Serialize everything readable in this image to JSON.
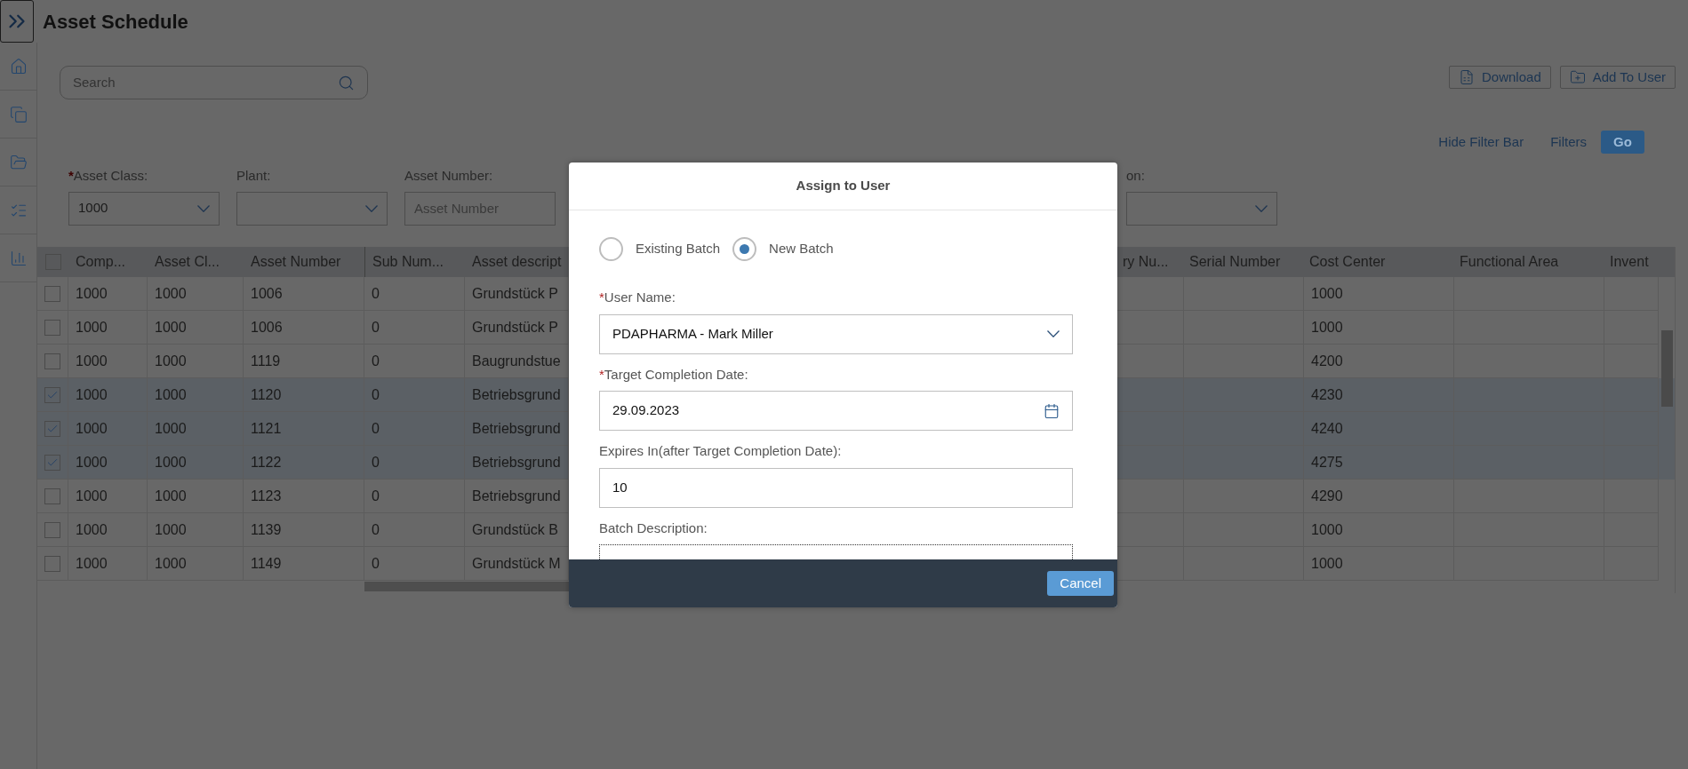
{
  "app": {
    "title": "Asset Schedule"
  },
  "search": {
    "placeholder": "Search"
  },
  "toolbar": {
    "buttons": [
      {
        "label": "Download",
        "kind": "download"
      },
      {
        "label": "Add To User",
        "kind": "add"
      }
    ]
  },
  "filter_bar": {
    "actions": [
      {
        "label": "Hide Filter Bar",
        "kind": "link"
      },
      {
        "label": "Filters",
        "kind": "link"
      },
      {
        "label": "Go",
        "kind": "primary"
      }
    ],
    "filters": [
      {
        "label": "Asset Class:",
        "required_mark": "*",
        "kind": "select",
        "value": "1000"
      },
      {
        "label": "Plant:",
        "kind": "select"
      },
      {
        "label": "Asset Number:",
        "kind": "input",
        "placeholder": "Asset Number"
      },
      {
        "label": "on:",
        "kind": "select"
      }
    ]
  },
  "table": {
    "select_all": false,
    "columns": [
      {
        "label": "Comp..."
      },
      {
        "label": "Asset Cl..."
      },
      {
        "label": "Asset Number"
      },
      {
        "label": "Sub Num..."
      },
      {
        "label": "Asset descript"
      },
      {
        "label": "ry Nu..."
      },
      {
        "label": "Serial Number"
      },
      {
        "label": "Cost Center"
      },
      {
        "label": "Functional Area"
      },
      {
        "label": "Invent"
      }
    ],
    "rows": [
      {
        "selected": false,
        "company": "1000",
        "asset_class": "1000",
        "asset_number": "1006",
        "sub_number": "0",
        "description": "Grundstück P",
        "cost_center": "1000"
      },
      {
        "selected": false,
        "company": "1000",
        "asset_class": "1000",
        "asset_number": "1006",
        "sub_number": "0",
        "description": "Grundstück P",
        "cost_center": "1000"
      },
      {
        "selected": false,
        "company": "1000",
        "asset_class": "1000",
        "asset_number": "1119",
        "sub_number": "0",
        "description": "Baugrundstue",
        "cost_center": "4200"
      },
      {
        "selected": true,
        "company": "1000",
        "asset_class": "1000",
        "asset_number": "1120",
        "sub_number": "0",
        "description": "Betriebsgrund",
        "cost_center": "4230"
      },
      {
        "selected": true,
        "company": "1000",
        "asset_class": "1000",
        "asset_number": "1121",
        "sub_number": "0",
        "description": "Betriebsgrund",
        "cost_center": "4240"
      },
      {
        "selected": true,
        "company": "1000",
        "asset_class": "1000",
        "asset_number": "1122",
        "sub_number": "0",
        "description": "Betriebsgrund",
        "cost_center": "4275"
      },
      {
        "selected": false,
        "company": "1000",
        "asset_class": "1000",
        "asset_number": "1123",
        "sub_number": "0",
        "description": "Betriebsgrund",
        "cost_center": "4290"
      },
      {
        "selected": false,
        "company": "1000",
        "asset_class": "1000",
        "asset_number": "1139",
        "sub_number": "0",
        "description": "Grundstück B",
        "cost_center": "1000"
      },
      {
        "selected": false,
        "company": "1000",
        "asset_class": "1000",
        "asset_number": "1149",
        "sub_number": "0",
        "description": "Grundstück M",
        "cost_center": "1000"
      }
    ]
  },
  "dialog": {
    "title": "Assign to User",
    "radios": [
      {
        "label": "Existing Batch",
        "selected": false
      },
      {
        "label": "New Batch",
        "selected": true
      }
    ],
    "fields": [
      {
        "label": "User Name:",
        "required_mark": "*",
        "kind": "select",
        "value": "PDAPHARMA - Mark Miller"
      },
      {
        "label": "Target Completion Date:",
        "required_mark": "*",
        "kind": "date",
        "value": "29.09.2023"
      },
      {
        "label": "Expires In(after Target Completion Date):",
        "kind": "input",
        "value": "10"
      },
      {
        "label": "Batch Description:",
        "kind": "textarea"
      }
    ],
    "buttons": [
      {
        "label": "Cancel"
      }
    ]
  }
}
